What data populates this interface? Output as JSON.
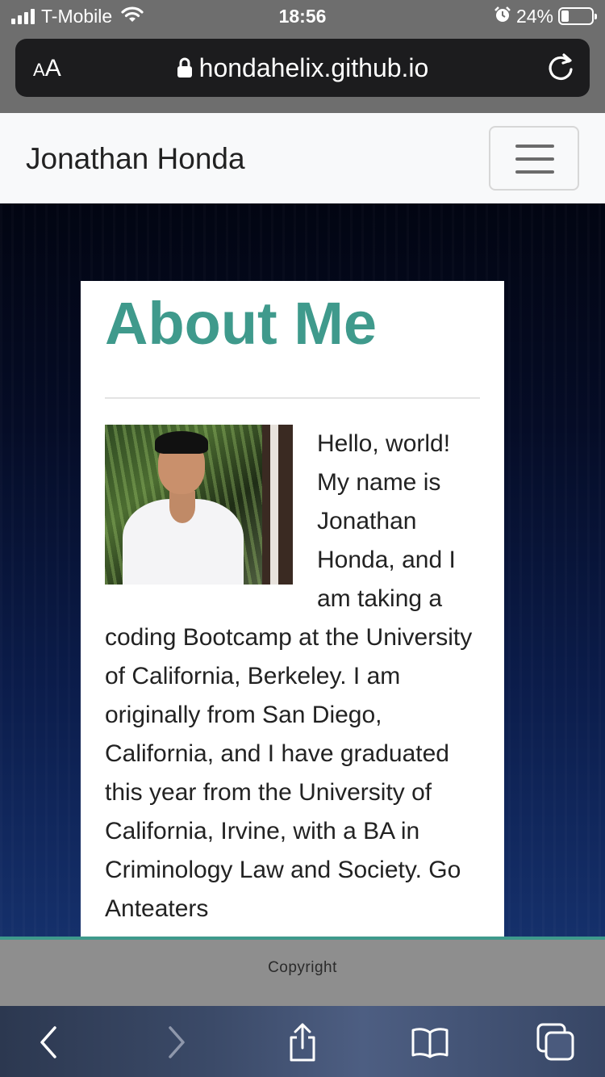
{
  "status_bar": {
    "carrier": "T-Mobile",
    "time": "18:56",
    "battery_percent": "24%",
    "battery_level": 0.24,
    "signal_bars": 4
  },
  "url_bar": {
    "text_size_label": "AA",
    "url": "hondahelix.github.io"
  },
  "navbar": {
    "brand": "Jonathan Honda"
  },
  "about": {
    "title": "About Me",
    "body": "Hello, world! My name is Jonathan Honda, and I am taking a coding Bootcamp at the University of California, Berkeley. I am originally from San Diego, California, and I have graduated this year from the University of California, Irvine, with a BA in Criminology Law and Society. Go Anteaters"
  },
  "footer": {
    "copyright": "Copyright"
  },
  "toolbar": {
    "buttons": [
      "back",
      "forward",
      "share",
      "bookmarks",
      "tabs"
    ]
  },
  "colors": {
    "accent": "#3f9a8c",
    "status_bar_bg": "#6e6e6e",
    "navbar_bg": "#f8f9fa",
    "footer_bg": "#8e8e8e"
  }
}
